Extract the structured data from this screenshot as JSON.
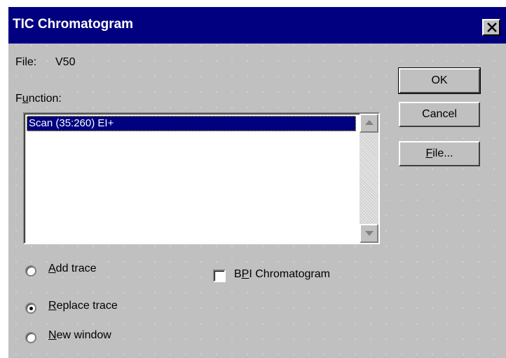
{
  "window": {
    "title": "TIC Chromatogram",
    "close_glyph": "✕"
  },
  "file": {
    "label": "File:",
    "value": "V50"
  },
  "function": {
    "label_before": "F",
    "label_underlined": "u",
    "label_after": "nction:",
    "items": [
      "Scan (35:260) EI+"
    ]
  },
  "buttons": {
    "ok": "OK",
    "cancel": "Cancel",
    "file_underlined": "F",
    "file_rest": "ile..."
  },
  "trace_options": {
    "add": {
      "u": "A",
      "rest": "dd trace",
      "checked": false
    },
    "replace": {
      "u": "R",
      "rest": "eplace trace",
      "checked": true
    },
    "new_window": {
      "u": "N",
      "rest": "ew window",
      "checked": false
    }
  },
  "bpi": {
    "before": "B",
    "u": "P",
    "after": "I Chromatogram",
    "checked": false
  },
  "colors": {
    "titlebar": "#000080",
    "face": "#c0c0c0",
    "selection": "#000080"
  }
}
